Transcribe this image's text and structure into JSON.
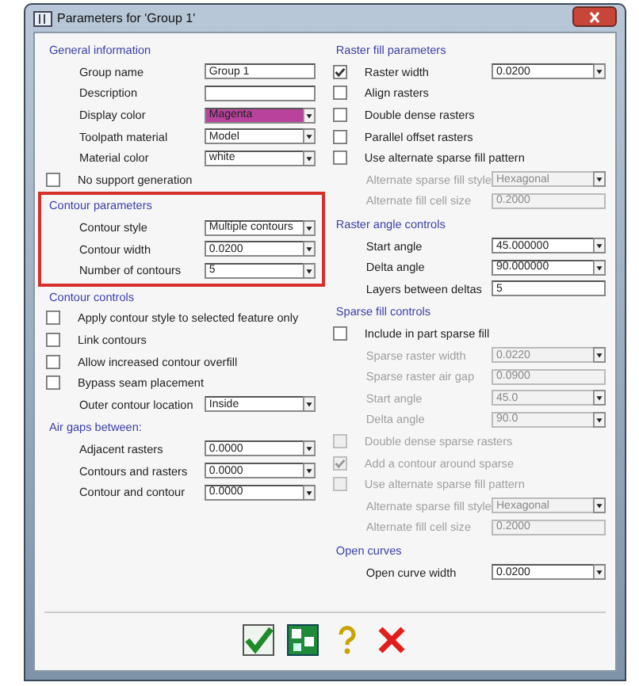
{
  "window": {
    "title": "Parameters for 'Group 1'"
  },
  "columns": [
    {
      "sections": [
        {
          "heading": "General information",
          "highlighted": false,
          "rows": [
            {
              "kind": "field",
              "label": "Group name",
              "value": "Group 1",
              "dropdown": false,
              "disabled": false
            },
            {
              "kind": "field",
              "label": "Description",
              "dropdown": false,
              "disabled": false
            },
            {
              "kind": "field",
              "label": "Display color",
              "value": "Magenta",
              "dropdown": true,
              "disabled": false,
              "color": "#b8429c"
            },
            {
              "kind": "field",
              "label": "Toolpath material",
              "value": "Model",
              "dropdown": true,
              "disabled": false
            },
            {
              "kind": "field",
              "label": "Material color",
              "value": "white",
              "dropdown": true,
              "disabled": false
            },
            {
              "kind": "check",
              "label": "No support generation",
              "checked": false,
              "disabled": false
            }
          ]
        },
        {
          "heading": "Contour parameters",
          "highlighted": true,
          "rows": [
            {
              "kind": "field",
              "label": "Contour style",
              "value": "Multiple contours",
              "dropdown": true,
              "disabled": false
            },
            {
              "kind": "field",
              "label": "Contour width",
              "value": "0.0200",
              "dropdown": true,
              "disabled": false
            },
            {
              "kind": "field",
              "label": "Number of contours",
              "value": "5",
              "dropdown": true,
              "disabled": false
            }
          ]
        },
        {
          "heading": "Contour controls",
          "highlighted": false,
          "rows": [
            {
              "kind": "check",
              "label": "Apply contour style to selected feature only",
              "checked": false,
              "disabled": false
            },
            {
              "kind": "check",
              "label": "Link contours",
              "checked": false,
              "disabled": false
            },
            {
              "kind": "check",
              "label": "Allow increased contour overfill",
              "checked": false,
              "disabled": false
            },
            {
              "kind": "check",
              "label": "Bypass seam placement",
              "checked": false,
              "disabled": false
            },
            {
              "kind": "field",
              "label": "Outer contour location",
              "value": "Inside",
              "dropdown": true,
              "disabled": false
            }
          ]
        },
        {
          "heading": "Air gaps between:",
          "highlighted": false,
          "rows": [
            {
              "kind": "field",
              "label": "Adjacent rasters",
              "value": "0.0000",
              "dropdown": true,
              "disabled": false
            },
            {
              "kind": "field",
              "label": "Contours and rasters",
              "value": "0.0000",
              "dropdown": true,
              "disabled": false
            },
            {
              "kind": "field",
              "label": "Contour and contour",
              "value": "0.0000",
              "dropdown": true,
              "disabled": false
            }
          ]
        }
      ]
    },
    {
      "sections": [
        {
          "heading": "Raster fill parameters",
          "highlighted": false,
          "rows": [
            {
              "kind": "checkfield",
              "label": "Raster width",
              "checked": true,
              "value": "0.0200",
              "dropdown": true,
              "disabled": false
            },
            {
              "kind": "check",
              "label": "Align rasters",
              "checked": false,
              "disabled": false
            },
            {
              "kind": "check",
              "label": "Double dense rasters",
              "checked": false,
              "disabled": false
            },
            {
              "kind": "check",
              "label": "Parallel offset rasters",
              "checked": false,
              "disabled": false
            },
            {
              "kind": "check",
              "label": "Use alternate sparse fill pattern",
              "checked": false,
              "disabled": false
            },
            {
              "kind": "field",
              "label": "Alternate sparse fill style",
              "value": "Hexagonal",
              "dropdown": true,
              "disabled": true
            },
            {
              "kind": "field",
              "label": "Alternate fill cell size",
              "value": "0.2000",
              "dropdown": false,
              "disabled": true
            }
          ]
        },
        {
          "heading": "Raster angle controls",
          "highlighted": false,
          "rows": [
            {
              "kind": "field",
              "label": "Start angle",
              "value": "45.000000",
              "dropdown": true,
              "disabled": false
            },
            {
              "kind": "field",
              "label": "Delta angle",
              "value": "90.000000",
              "dropdown": true,
              "disabled": false
            },
            {
              "kind": "field",
              "label": "Layers between deltas",
              "value": "5",
              "dropdown": false,
              "disabled": false
            }
          ]
        },
        {
          "heading": "Sparse fill controls",
          "highlighted": false,
          "rows": [
            {
              "kind": "check",
              "label": "Include in part sparse fill",
              "checked": false,
              "disabled": false
            },
            {
              "kind": "field",
              "label": "Sparse raster width",
              "value": "0.0220",
              "dropdown": true,
              "disabled": true
            },
            {
              "kind": "field",
              "label": "Sparse raster air gap",
              "value": "0.0900",
              "dropdown": false,
              "disabled": true
            },
            {
              "kind": "field",
              "label": "Start angle",
              "value": "45.0",
              "dropdown": true,
              "disabled": true
            },
            {
              "kind": "field",
              "label": "Delta angle",
              "value": "90.0",
              "dropdown": true,
              "disabled": true
            },
            {
              "kind": "check",
              "label": "Double dense sparse rasters",
              "checked": false,
              "disabled": true
            },
            {
              "kind": "check",
              "label": "Add a contour around sparse",
              "checked": true,
              "disabled": true
            },
            {
              "kind": "check",
              "label": "Use alternate sparse fill pattern",
              "checked": false,
              "disabled": true
            },
            {
              "kind": "field",
              "label": "Alternate sparse fill style",
              "value": "Hexagonal",
              "dropdown": true,
              "disabled": true
            },
            {
              "kind": "field",
              "label": "Alternate fill cell size",
              "value": "0.2000",
              "dropdown": false,
              "disabled": true
            }
          ]
        },
        {
          "heading": "Open curves",
          "highlighted": false,
          "rows": [
            {
              "kind": "field",
              "label": "Open curve width",
              "value": "0.0200",
              "dropdown": true,
              "disabled": false
            }
          ]
        }
      ]
    }
  ],
  "buttons": [
    {
      "kind": "ok"
    },
    {
      "kind": "apply"
    },
    {
      "kind": "help"
    },
    {
      "kind": "cancel"
    }
  ]
}
